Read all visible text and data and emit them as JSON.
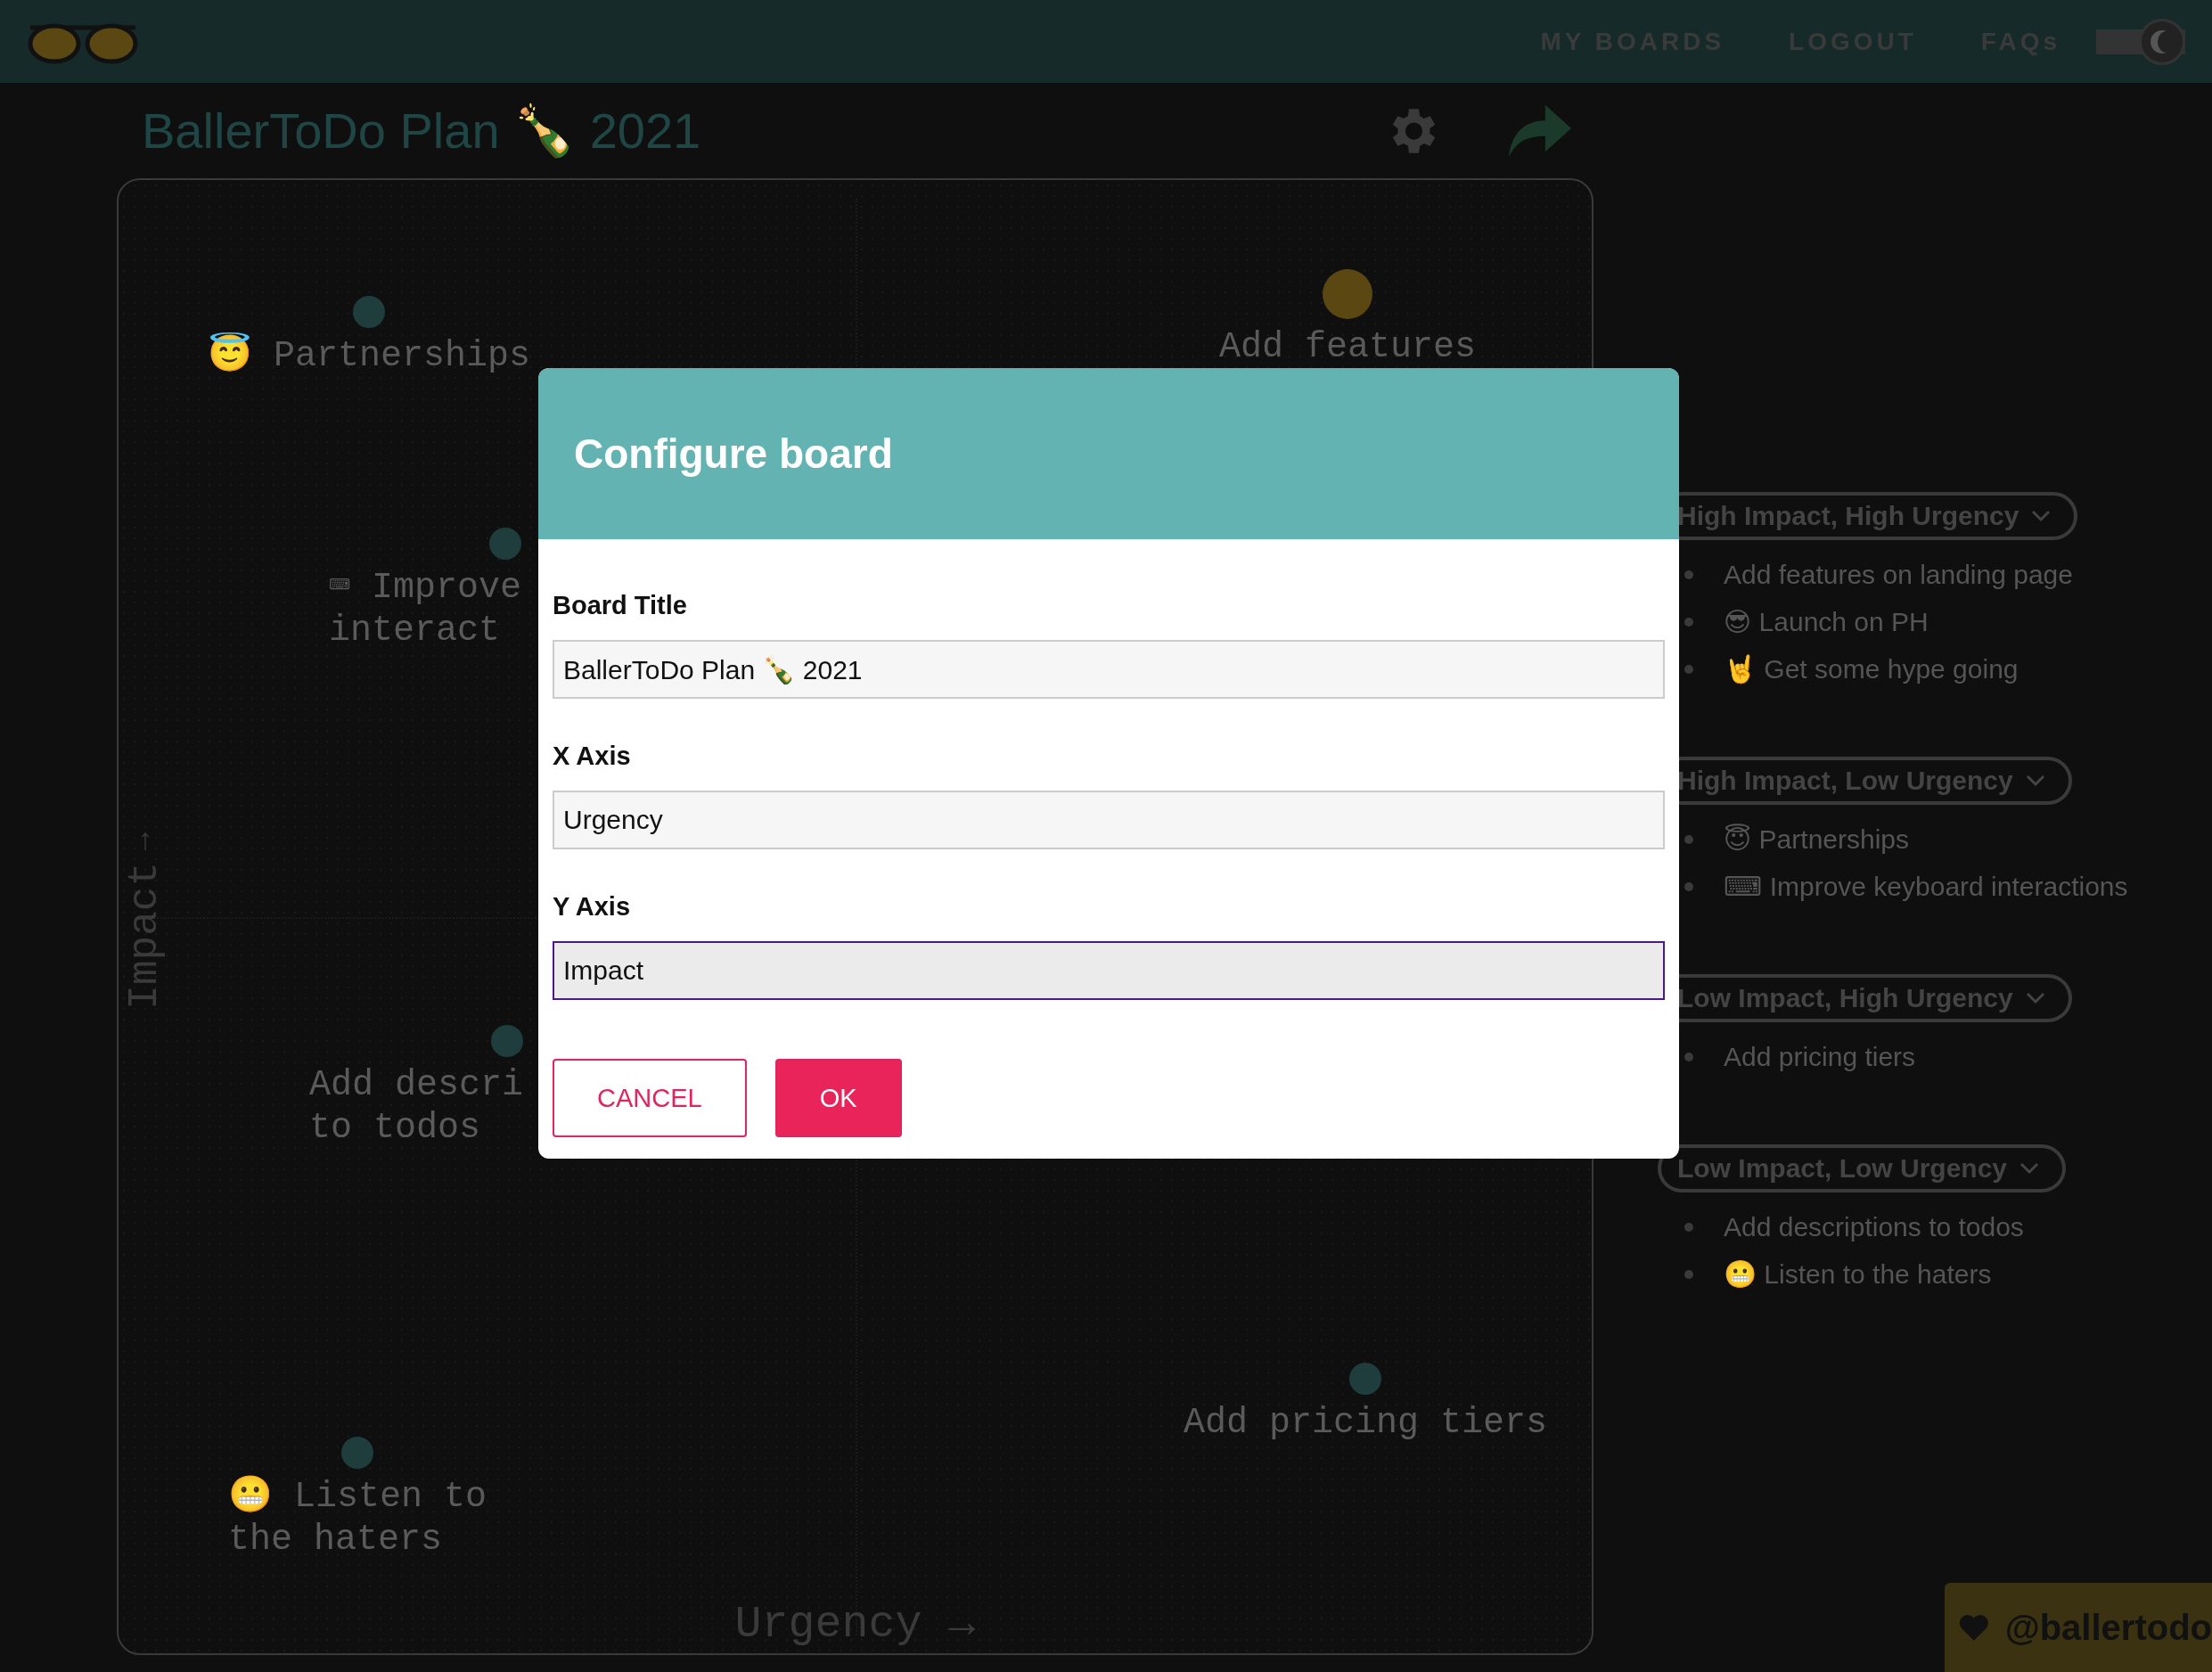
{
  "header": {
    "nav": [
      {
        "label": "MY BOARDS"
      },
      {
        "label": "LOGOUT"
      },
      {
        "label": "FAQs"
      }
    ],
    "dark_mode": true
  },
  "board": {
    "title": "BallerToDo Plan 🍾 2021",
    "y_arrow": "↑",
    "y_label": "Impact",
    "x_label": "Urgency →",
    "items": [
      {
        "lines": [
          "😇 Partnerships"
        ],
        "color": "#1f3d3d"
      },
      {
        "lines": [
          "Add features"
        ],
        "color": "#5a4712"
      },
      {
        "lines": [
          "⌨ Improve",
          "interact"
        ],
        "color": "#1f3d3d"
      },
      {
        "lines": [
          "Add descri",
          "to todos"
        ],
        "color": "#1f3d3d"
      },
      {
        "lines": [
          "Add pricing tiers"
        ],
        "color": "#1f3d3d"
      },
      {
        "lines": [
          "😬 Listen to",
          "the haters"
        ],
        "color": "#1f3d3d"
      }
    ]
  },
  "groups": [
    {
      "title": "High Impact, High Urgency",
      "items": [
        "Add features on landing page",
        "😎 Launch on PH",
        "🤘 Get some hype going"
      ]
    },
    {
      "title": "High Impact, Low Urgency",
      "items": [
        "😇 Partnerships",
        "⌨ Improve keyboard interactions"
      ]
    },
    {
      "title": "Low Impact, High Urgency",
      "items": [
        "Add pricing tiers"
      ]
    },
    {
      "title": "Low Impact, Low Urgency",
      "items": [
        "Add descriptions to todos",
        "😬 Listen to the haters"
      ]
    }
  ],
  "dialog": {
    "title": "Configure board",
    "fields": [
      {
        "label": "Board Title",
        "value": "BallerToDo Plan 🍾 2021",
        "focused": false
      },
      {
        "label": "X Axis",
        "value": "Urgency",
        "focused": false
      },
      {
        "label": "Y Axis",
        "value": "Impact",
        "focused": true
      }
    ],
    "buttons": [
      {
        "label": "CANCEL",
        "kind": "secondary"
      },
      {
        "label": "OK",
        "kind": "primary"
      }
    ]
  },
  "badge": {
    "label": "@ballertodo"
  }
}
